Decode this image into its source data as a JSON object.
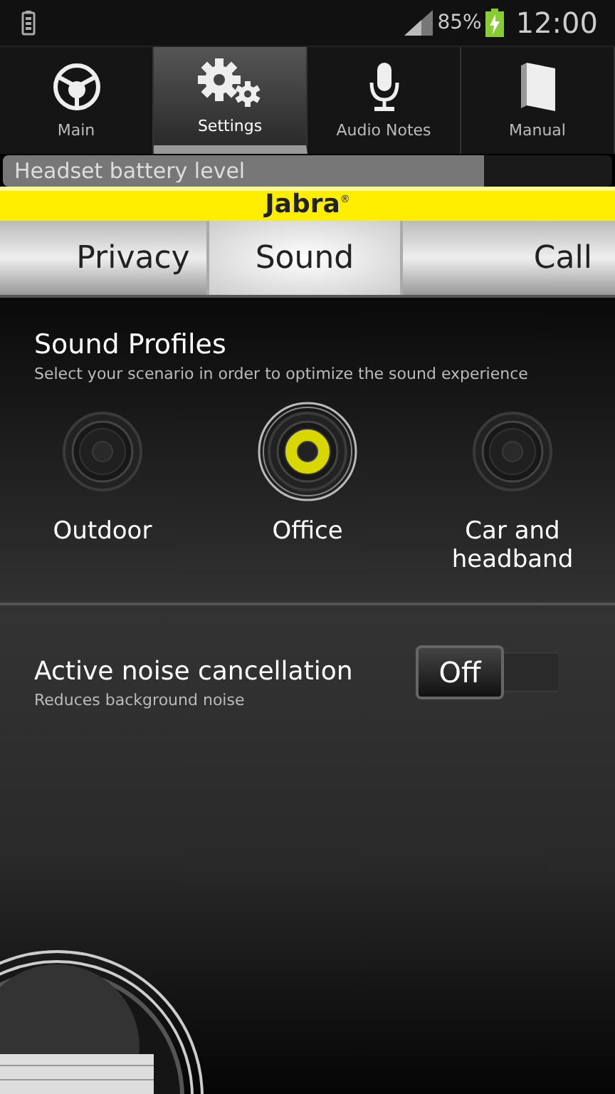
{
  "status_bar": {
    "battery": "85%",
    "time": "12:00"
  },
  "tabs": [
    {
      "label": "Main",
      "selected": false
    },
    {
      "label": "Settings",
      "selected": true
    },
    {
      "label": "Audio Notes",
      "selected": false
    },
    {
      "label": "Manual",
      "selected": false
    }
  ],
  "battery_bar": {
    "label": "Headset battery level",
    "level": 0.79
  },
  "brand": {
    "logo": "Jabra",
    "mark": "®"
  },
  "sections": [
    {
      "label": "Privacy",
      "selected": false
    },
    {
      "label": "Sound",
      "selected": true
    },
    {
      "label": "Call",
      "selected": false
    }
  ],
  "sound_profiles": {
    "title": "Sound Profiles",
    "subtitle": "Select your scenario in order to optimize the sound experience",
    "profiles": [
      {
        "label": "Outdoor",
        "selected": false
      },
      {
        "label": "Office",
        "selected": true
      },
      {
        "label": "Car and headband",
        "selected": false
      }
    ]
  },
  "noise_cancellation": {
    "title": "Active noise cancellation",
    "subtitle": "Reduces background noise",
    "on": false,
    "state_label": "Off"
  }
}
